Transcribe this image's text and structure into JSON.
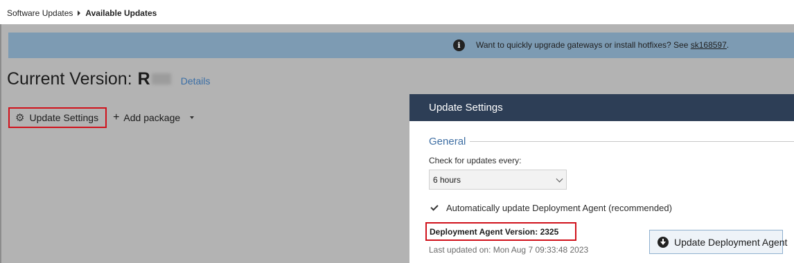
{
  "breadcrumb": {
    "parent": "Software Updates",
    "current": "Available Updates"
  },
  "banner": {
    "icon": "info-icon",
    "text_prefix": "Want to quickly upgrade gateways or install hotfixes? See ",
    "link_text": "sk168597",
    "text_suffix": ".",
    "background_color": "#7d9bb3"
  },
  "version": {
    "label": "Current Version:",
    "value_visible": "R",
    "details_link": "Details"
  },
  "toolbar": {
    "update_settings_label": "Update Settings",
    "update_settings_icon": "gear-icon",
    "add_package_label": "Add package",
    "add_package_icon": "plus-icon",
    "highlight_color": "#d0111b"
  },
  "panel": {
    "title": "Update Settings",
    "header_color": "#2d3e56",
    "section_title": "General",
    "check_interval_label": "Check for updates every:",
    "check_interval_value": "6 hours",
    "auto_update_checked": true,
    "auto_update_label": "Automatically update Deployment Agent (recommended)",
    "agent_version_text": "Deployment Agent Version: 2325",
    "last_updated_text": "Last updated on: Mon Aug 7 09:33:48 2023",
    "update_agent_button": "Update Deployment Agent",
    "update_agent_icon": "download-circle-icon"
  }
}
